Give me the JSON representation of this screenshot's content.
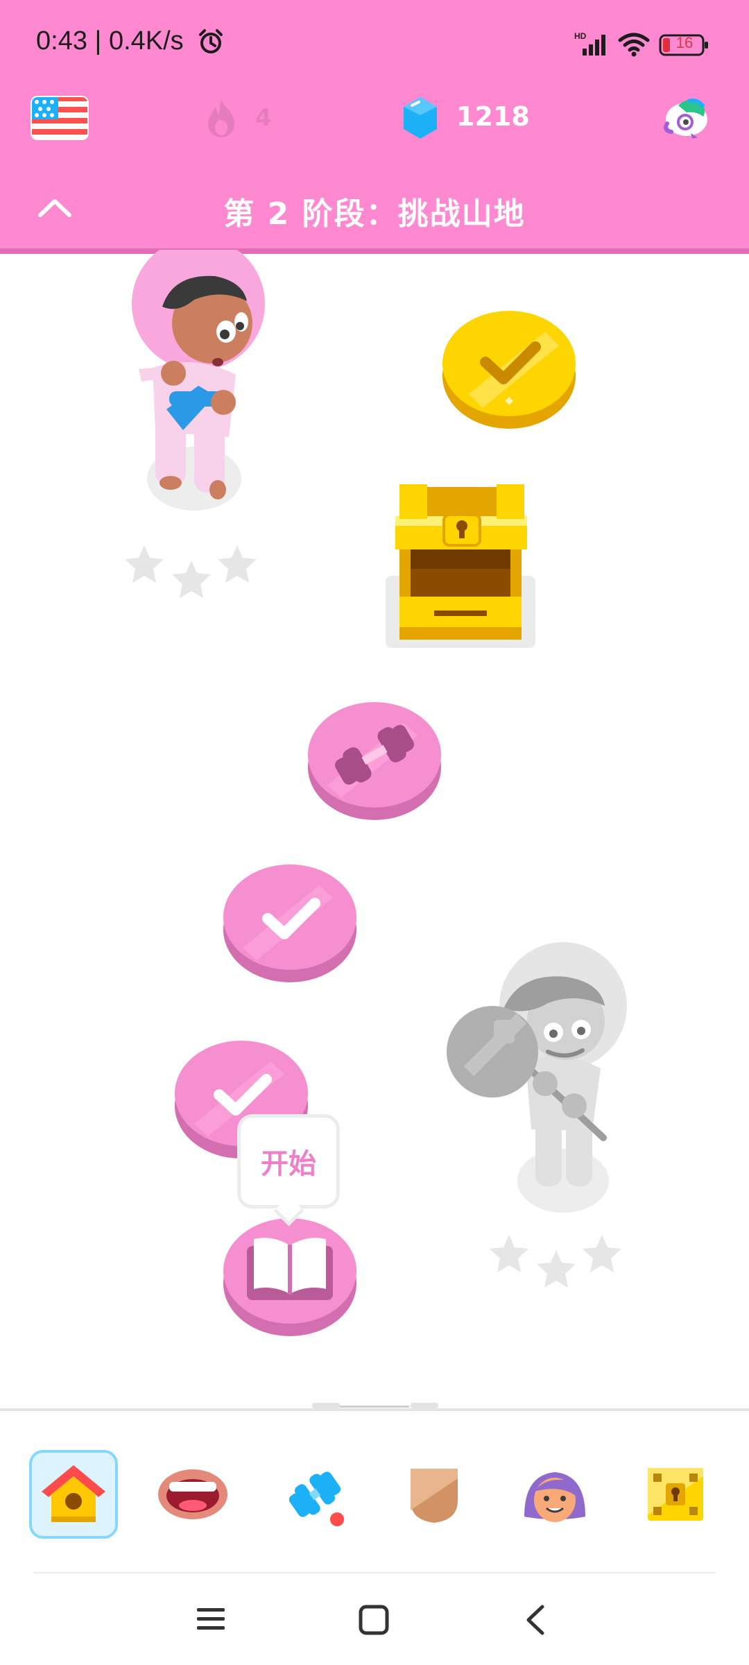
{
  "status_bar": {
    "time": "0:43 | 0.4K/s",
    "network_label": "HD",
    "battery": "16",
    "icons": [
      "alarm-icon",
      "signal-icon",
      "wifi-icon",
      "battery-icon"
    ]
  },
  "top_bar": {
    "course_flag": "us-flag-icon",
    "streak_count": "4",
    "gems_count": "1218",
    "mascot_icon": "duo-mascot-icon"
  },
  "unit": {
    "title": "第 2 阶段：挑战山地",
    "collapse_icon": "chevron-up-icon"
  },
  "path": {
    "nodes": [
      {
        "name": "character-karate",
        "state": "completed",
        "stars": 3
      },
      {
        "name": "gold-coin-node",
        "state": "completed",
        "icon": "check-icon"
      },
      {
        "name": "treasure-chest-node",
        "state": "opened",
        "icon": "treasure-chest-icon"
      },
      {
        "name": "practice-node",
        "state": "available",
        "icon": "dumbbell-icon"
      },
      {
        "name": "lesson-node-1",
        "state": "completed",
        "icon": "check-icon"
      },
      {
        "name": "lesson-node-2",
        "state": "completed",
        "icon": "check-icon"
      },
      {
        "name": "lesson-node-current",
        "state": "current",
        "icon": "book-icon"
      },
      {
        "name": "character-locked",
        "state": "locked",
        "stars": 3
      }
    ],
    "start_label": "开始"
  },
  "bottom_nav": {
    "items": [
      {
        "name": "home",
        "icon": "home-icon",
        "active": true
      },
      {
        "name": "speak",
        "icon": "mouth-icon",
        "active": false
      },
      {
        "name": "practice",
        "icon": "dumbbell-icon",
        "active": false,
        "badge": true
      },
      {
        "name": "leagues",
        "icon": "shield-icon",
        "active": false
      },
      {
        "name": "profile",
        "icon": "avatar-icon",
        "active": false
      },
      {
        "name": "shop",
        "icon": "treasure-chest-icon",
        "active": false
      }
    ]
  },
  "system_nav": {
    "icons": [
      "menu-icon",
      "home-square-icon",
      "back-chevron-icon"
    ]
  },
  "colors": {
    "header_pink": "#ff89d1",
    "node_pink": "#f58fcf",
    "node_pink_dark": "#d36fb1",
    "gold": "#ffd500",
    "gold_dark": "#e5a500",
    "gem_blue": "#1cb0f6",
    "active_nav_bg": "#ddf4ff",
    "active_nav_border": "#84d8ff"
  }
}
